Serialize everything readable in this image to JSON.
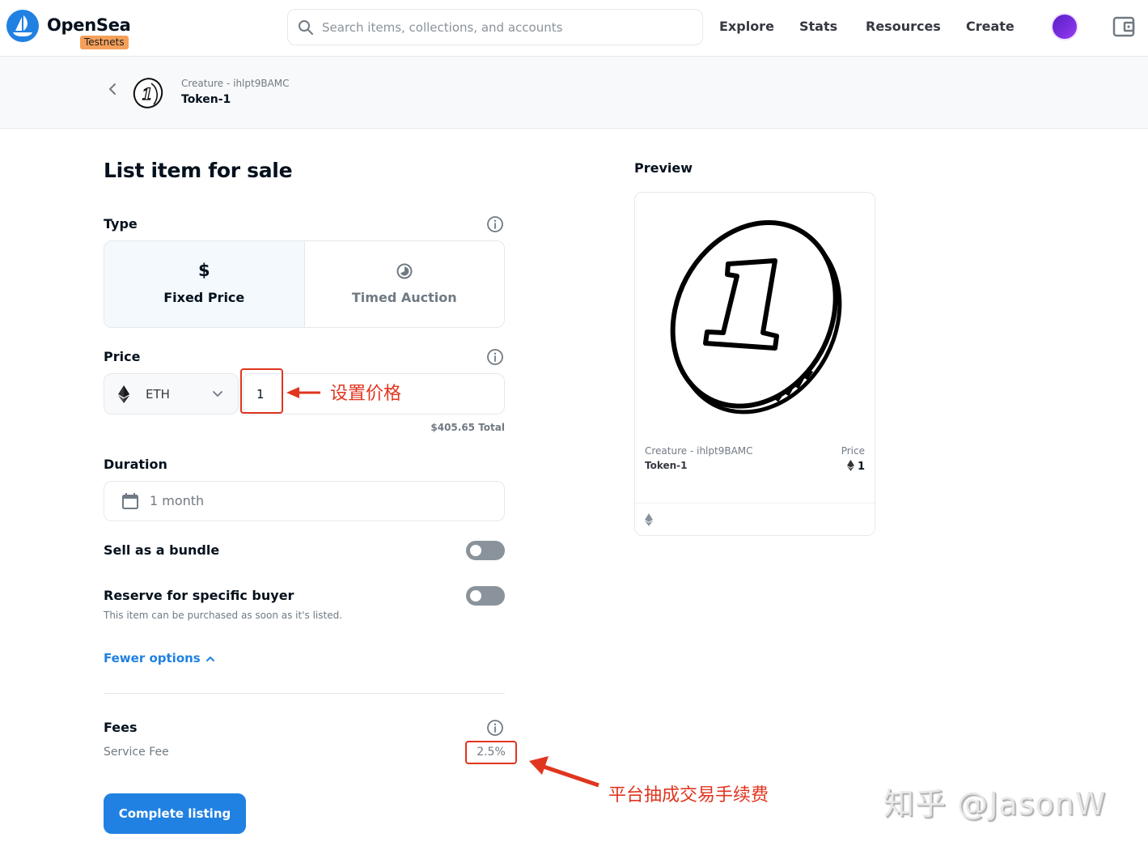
{
  "nav": {
    "brand": "OpenSea",
    "badge": "Testnets",
    "search_placeholder": "Search items, collections, and accounts",
    "search_value": "",
    "links": [
      "Explore",
      "Stats",
      "Resources",
      "Create"
    ],
    "icons": {
      "logo": "opensea-logo-icon",
      "search": "search-icon",
      "avatar": "avatar",
      "wallet": "wallet-icon"
    }
  },
  "breadcrumb": {
    "collection": "Creature - ihlpt9BAMC",
    "token": "Token-1"
  },
  "form": {
    "title": "List item for sale",
    "type": {
      "label": "Type",
      "options": [
        {
          "label": "Fixed Price",
          "icon": "$",
          "selected": true
        },
        {
          "label": "Timed Auction",
          "icon": "clock-icon",
          "selected": false
        }
      ]
    },
    "price": {
      "label": "Price",
      "currency": "ETH",
      "value": "1",
      "total": "$405.65 Total"
    },
    "duration": {
      "label": "Duration",
      "value": "1 month"
    },
    "bundle": {
      "label": "Sell as a bundle",
      "enabled": false
    },
    "reserve": {
      "label": "Reserve for specific buyer",
      "enabled": false,
      "hint": "This item can be purchased as soon as it's listed."
    },
    "fewer_options": "Fewer options",
    "fees": {
      "label": "Fees",
      "service_fee_label": "Service Fee",
      "service_fee_value": "2.5%"
    },
    "submit": "Complete listing"
  },
  "preview": {
    "title": "Preview",
    "collection": "Creature - ihlpt9BAMC",
    "token": "Token-1",
    "price_label": "Price",
    "price_value": "1"
  },
  "annotations": {
    "price_note": "设置价格",
    "fee_note": "平台抽成交易手续费",
    "color": "#e0351f"
  },
  "watermark": "知乎 @JasonW",
  "colors": {
    "accent": "#2081e2",
    "testnets_badge": "#f5a05a",
    "toggle_off": "#8a939b",
    "text_primary": "#04111d",
    "text_secondary": "#707a83"
  }
}
